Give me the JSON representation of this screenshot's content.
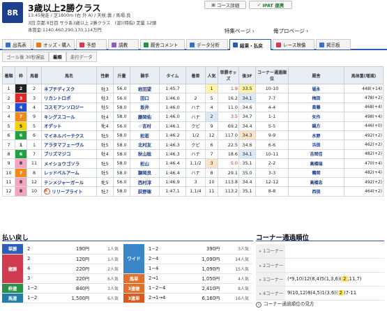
{
  "race": {
    "number": "8R",
    "title": "3歳以上2勝クラス",
    "info1": "13:45発走 / 芝1800m (右 外 A) / 天候:曇 / 馬場:良",
    "info2": "3回 京都 8日目 サラ系3歳以上 2勝クラス　(混)(特指) 定量 12頭",
    "info3": "本賞金:1140,460,290,170,114万円"
  },
  "header_buttons": {
    "course": "コース詳細",
    "ipat": "IPAT 連携"
  },
  "header_links": {
    "special": "特集ページ",
    "mine": "俺プロページ"
  },
  "tabs": [
    "出馬表",
    "オッズ・購入",
    "予想",
    "調教",
    "厩舎コメント",
    "データ分析",
    "結果・払戻",
    "レース映像",
    "掲示板"
  ],
  "subtabs": [
    "ゴール後 30秒遅延",
    "着順",
    "走行データ"
  ],
  "table_headers": [
    "着順",
    "枠",
    "馬番",
    "馬名",
    "性齢",
    "斤量",
    "騎手",
    "タイム",
    "着差",
    "人気",
    "単勝オッズ",
    "後3F",
    "コーナー通過順位",
    "厩舎",
    "馬体重(増減)"
  ],
  "frame_colors": {
    "1": {
      "bg": "#ffffff",
      "fg": "#222222"
    },
    "2": {
      "bg": "#222222",
      "fg": "#ffffff"
    },
    "3": {
      "bg": "#e02828",
      "fg": "#ffffff"
    },
    "4": {
      "bg": "#1f4fd0",
      "fg": "#ffffff"
    },
    "5": {
      "bg": "#f4d400",
      "fg": "#222222"
    },
    "6": {
      "bg": "#23a043",
      "fg": "#ffffff"
    },
    "7": {
      "bg": "#f08a1a",
      "fg": "#ffffff"
    },
    "8": {
      "bg": "#f6a5c0",
      "fg": "#222222"
    }
  },
  "results": [
    {
      "rank": "1",
      "frame": "2",
      "num": "2",
      "horse": "ネプチディスク",
      "sexage": "牡3",
      "weight": "56.0",
      "jockey": "岩田望",
      "time": "1:45.7",
      "margin": "",
      "pop": "1",
      "odds": "1.9",
      "last3f": "33.5",
      "corner": "10-10",
      "trainer": "堀永",
      "bw": "448(+14)",
      "pop_bg": "yellow",
      "odds_red": true,
      "l3_bg": "yellow"
    },
    {
      "rank": "2",
      "frame": "3",
      "num": "3",
      "horse": "リカントロポ",
      "sexage": "牡3",
      "weight": "56.0",
      "jockey": "田口",
      "time": "1:46.0",
      "margin": "2",
      "pop": "5",
      "odds": "16.2",
      "last3f": "34.1",
      "corner": "7-7",
      "trainer": "梅田",
      "bw": "478(+2)",
      "pop_bg": "",
      "odds_red": false,
      "l3_bg": "blue"
    },
    {
      "rank": "3",
      "frame": "4",
      "num": "4",
      "horse": "コスモアンソロジー",
      "sexage": "牡5",
      "weight": "58.0",
      "jockey": "坂井",
      "time": "1:46.0",
      "margin": "ハナ",
      "pop": "4",
      "odds": "11.0",
      "last3f": "34.6",
      "corner": "4-4",
      "trainer": "斎藤",
      "bw": "468(+4)",
      "pop_bg": "",
      "odds_red": false,
      "l3_bg": ""
    },
    {
      "rank": "4",
      "frame": "7",
      "num": "9",
      "horse": "キングスコール",
      "sexage": "牡4",
      "weight": "58.0",
      "jockey": "藤岡佑",
      "time": "1:46.0",
      "margin": "ハナ",
      "pop": "2",
      "odds": "3.5",
      "last3f": "34.7",
      "corner": "1-1",
      "trainer": "矢作",
      "bw": "498(+4)",
      "pop_bg": "blue",
      "odds_red": true,
      "l3_bg": ""
    },
    {
      "rank": "5",
      "frame": "5",
      "num": "5",
      "horse": "オデット",
      "sexage": "牝4",
      "weight": "56.0",
      "jockey": "☆吉村",
      "time": "1:46.1",
      "margin": "クビ",
      "pop": "9",
      "odds": "69.2",
      "last3f": "34.4",
      "corner": "5-5",
      "trainer": "鍋方",
      "bw": "446(+0)",
      "pop_bg": "",
      "odds_red": false,
      "l3_bg": ""
    },
    {
      "rank": "6",
      "frame": "6",
      "num": "6",
      "horse": "マイネルバーテクス",
      "sexage": "牡5",
      "weight": "58.0",
      "jockey": "松若",
      "time": "1:46.2",
      "margin": "1/2",
      "pop": "12",
      "odds": "117.0",
      "last3f": "34.3",
      "corner": "9-9",
      "trainer": "水野",
      "bw": "492(+2)",
      "pop_bg": "",
      "odds_red": false,
      "l3_bg": "peach"
    },
    {
      "rank": "7",
      "frame": "1",
      "num": "1",
      "horse": "アラタマフェーヴル",
      "sexage": "牡5",
      "weight": "58.0",
      "jockey": "北村友",
      "time": "1:46.3",
      "margin": "クビ",
      "pop": "6",
      "odds": "22.5",
      "last3f": "34.6",
      "corner": "6-6",
      "trainer": "浜田",
      "bw": "462(+2)",
      "pop_bg": "",
      "odds_red": false,
      "l3_bg": ""
    },
    {
      "rank": "8",
      "frame": "6",
      "num": "7",
      "horse": "ブリズマジコ",
      "sexage": "牡4",
      "weight": "58.0",
      "jockey": "秋山稔",
      "time": "1:46.3",
      "margin": "ハナ",
      "pop": "7",
      "odds": "18.6",
      "last3f": "34.1",
      "corner": "10-11",
      "trainer": "吉岡佳",
      "bw": "482(+2)",
      "pop_bg": "",
      "odds_red": false,
      "l3_bg": "blue"
    },
    {
      "rank": "9",
      "frame": "8",
      "num": "11",
      "horse": "メイショウゴソラ",
      "sexage": "牡5",
      "weight": "58.0",
      "jockey": "松山",
      "time": "1:46.4",
      "margin": "1.1/2",
      "pop": "3",
      "odds": "5.0",
      "last3f": "35.1",
      "corner": "2-2",
      "trainer": "高橋瑞",
      "bw": "470(+4)",
      "pop_bg": "peach",
      "odds_red": true,
      "l3_bg": ""
    },
    {
      "rank": "10",
      "frame": "7",
      "num": "8",
      "horse": "レッドベルアーム",
      "sexage": "牡5",
      "weight": "58.0",
      "jockey": "獅岡良",
      "time": "1:46.4",
      "margin": "ハナ",
      "pop": "8",
      "odds": "29.1",
      "last3f": "35.0",
      "corner": "3-3",
      "trainer": "鶴岡",
      "bw": "482(+4)",
      "pop_bg": "",
      "odds_red": false,
      "l3_bg": ""
    },
    {
      "rank": "11",
      "frame": "8",
      "num": "12",
      "horse": "テンメジャーガール",
      "sexage": "牝5",
      "weight": "56.0",
      "jockey": "西村淳",
      "time": "1:46.9",
      "margin": "3",
      "pop": "10",
      "odds": "113.8",
      "last3f": "34.4",
      "corner": "12-12",
      "trainer": "高橋忠",
      "bw": "492(+2)",
      "pop_bg": "",
      "odds_red": false,
      "l3_bg": ""
    },
    {
      "rank": "12",
      "frame": "8",
      "num": "10",
      "horse": "リリープライト",
      "sexage": "牡7",
      "weight": "58.0",
      "jockey": "荻野琢",
      "time": "1:47.1",
      "margin": "1.1/4",
      "pop": "11",
      "odds": "113.2",
      "last3f": "35.1",
      "corner": "8-8",
      "trainer": "西田",
      "bw": "464(+2)",
      "pop_bg": "",
      "odds_red": false,
      "l3_bg": ""
    }
  ],
  "payout": {
    "title": "払い戻し",
    "unit": "円",
    "left": [
      {
        "label": "単勝",
        "color": "#2d5fb8",
        "rows": [
          {
            "combo": "2",
            "amount": "190",
            "pop": "1人気"
          }
        ]
      },
      {
        "label": "複勝",
        "color": "#d13b50",
        "rows": [
          {
            "combo": "2",
            "amount": "120",
            "pop": "1人気"
          },
          {
            "combo": "4",
            "amount": "220",
            "pop": "2人気"
          },
          {
            "combo": "3",
            "amount": "220",
            "pop": "6人気"
          }
        ]
      },
      {
        "label": "枠連",
        "color": "#2b8f4b",
        "rows": [
          {
            "combo": "1−2",
            "amount": "840",
            "pop": "3人気"
          }
        ]
      },
      {
        "label": "馬連",
        "color": "#1f7fa6",
        "rows": [
          {
            "combo": "1−2",
            "amount": "1,500",
            "pop": "6人気"
          }
        ]
      }
    ],
    "right": [
      {
        "label": "ワイド",
        "color": "#3b86c9",
        "rows": [
          {
            "combo": "1−2",
            "amount": "390",
            "pop": "3人気"
          },
          {
            "combo": "2−4",
            "amount": "1,090",
            "pop": "14人気"
          },
          {
            "combo": "1−4",
            "amount": "1,090",
            "pop": "15人気"
          }
        ]
      },
      {
        "label": "馬単",
        "color": "#e0702b",
        "rows": [
          {
            "combo": "2→1",
            "amount": "1,050",
            "pop": "4人気"
          }
        ]
      },
      {
        "label": "3連複",
        "color": "#e0702b",
        "rows": [
          {
            "combo": "1−2−4",
            "amount": "2,410",
            "pop": "8人気"
          }
        ]
      },
      {
        "label": "3連単",
        "color": "#d85a1f",
        "rows": [
          {
            "combo": "2→1→4",
            "amount": "6,160",
            "pop": "16人気"
          }
        ]
      }
    ]
  },
  "corner": {
    "title": "コーナー通過順位",
    "rows": [
      {
        "label": "1コーナー",
        "pre": "",
        "hl": "",
        "post": ""
      },
      {
        "label": "2コーナー",
        "pre": "",
        "hl": "",
        "post": ""
      },
      {
        "label": "3コーナー",
        "pre": "(*9,10)12(8,4)5(1,3,6)(",
        "hl": "2",
        "post": ",11,7)"
      },
      {
        "label": "4コーナー",
        "pre": "9(10,12)8(4,5)1(3,6)(",
        "hl": "2",
        "post": ")7-11"
      }
    ],
    "note": "コーナー通過順位の見方"
  }
}
